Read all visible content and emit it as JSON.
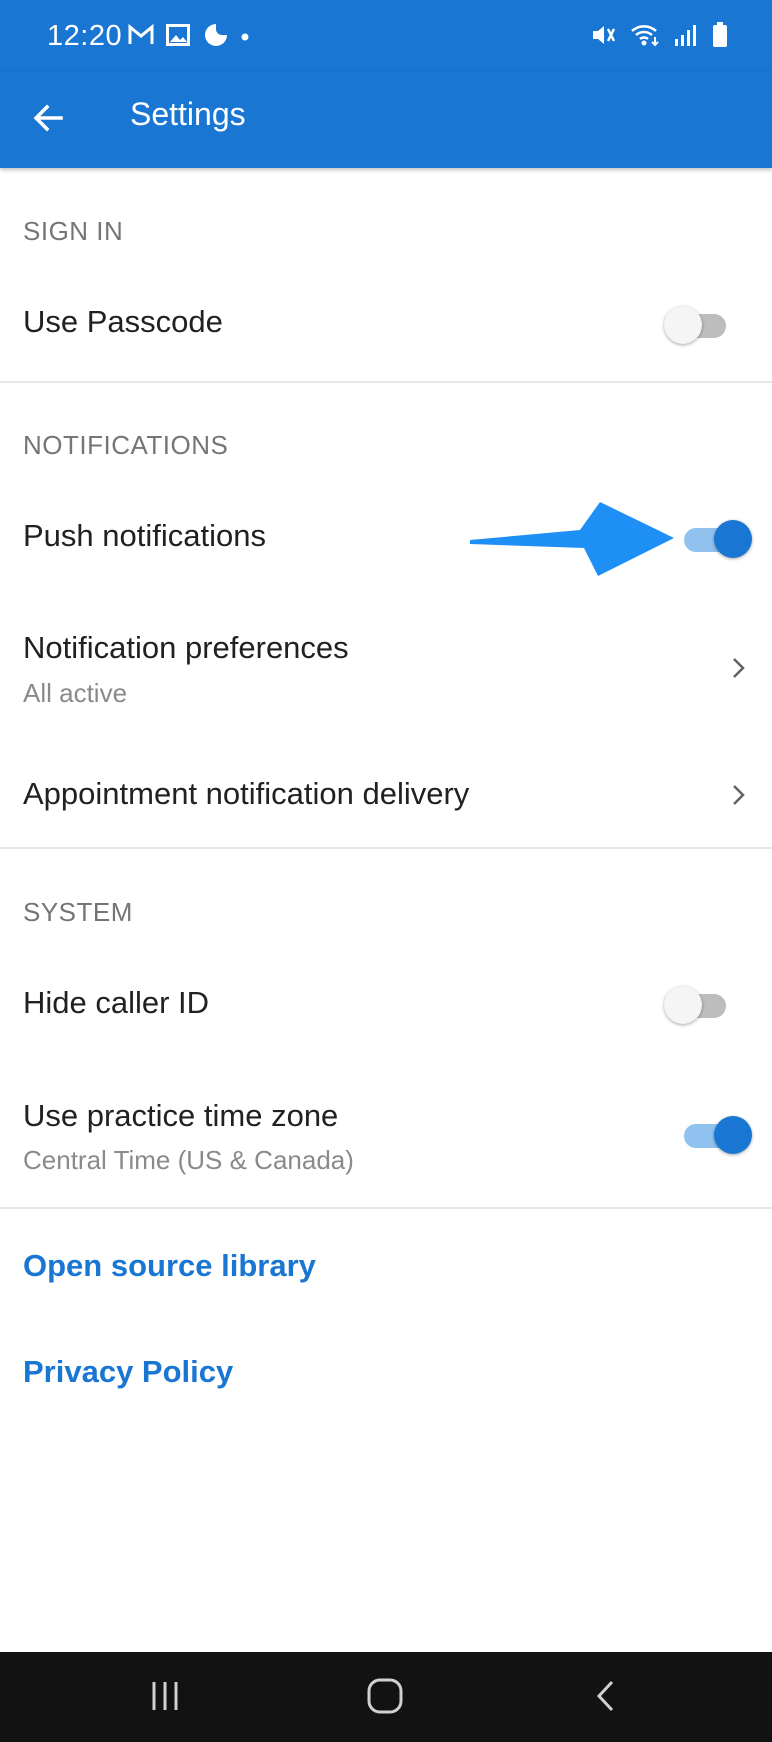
{
  "status_bar": {
    "time": "12:20",
    "left_icons": [
      "gmail-icon",
      "gallery-icon",
      "phone-app-icon",
      "dot-icon"
    ],
    "right_icons": [
      "mute-vibrate-icon",
      "wifi-icon",
      "signal-icon",
      "battery-icon"
    ]
  },
  "app_bar": {
    "title": "Settings",
    "back_icon": "arrow-left-icon"
  },
  "sections": {
    "sign_in": {
      "header": "SIGN IN",
      "use_passcode": {
        "label": "Use Passcode",
        "enabled": false
      }
    },
    "notifications": {
      "header": "NOTIFICATIONS",
      "push": {
        "label": "Push notifications",
        "enabled": true
      },
      "preferences": {
        "label": "Notification preferences",
        "value": "All active"
      },
      "appointment_delivery": {
        "label": "Appointment notification delivery"
      }
    },
    "system": {
      "header": "SYSTEM",
      "hide_caller_id": {
        "label": "Hide caller ID",
        "enabled": false
      },
      "practice_time_zone": {
        "label": "Use practice time zone",
        "value": "Central Time (US & Canada)",
        "enabled": true
      }
    }
  },
  "links": {
    "open_source": "Open source library",
    "privacy_policy": "Privacy Policy"
  },
  "colors": {
    "primary": "#1976d2",
    "annotation_arrow": "#1e8ff5",
    "nav_bar": "#121212"
  }
}
